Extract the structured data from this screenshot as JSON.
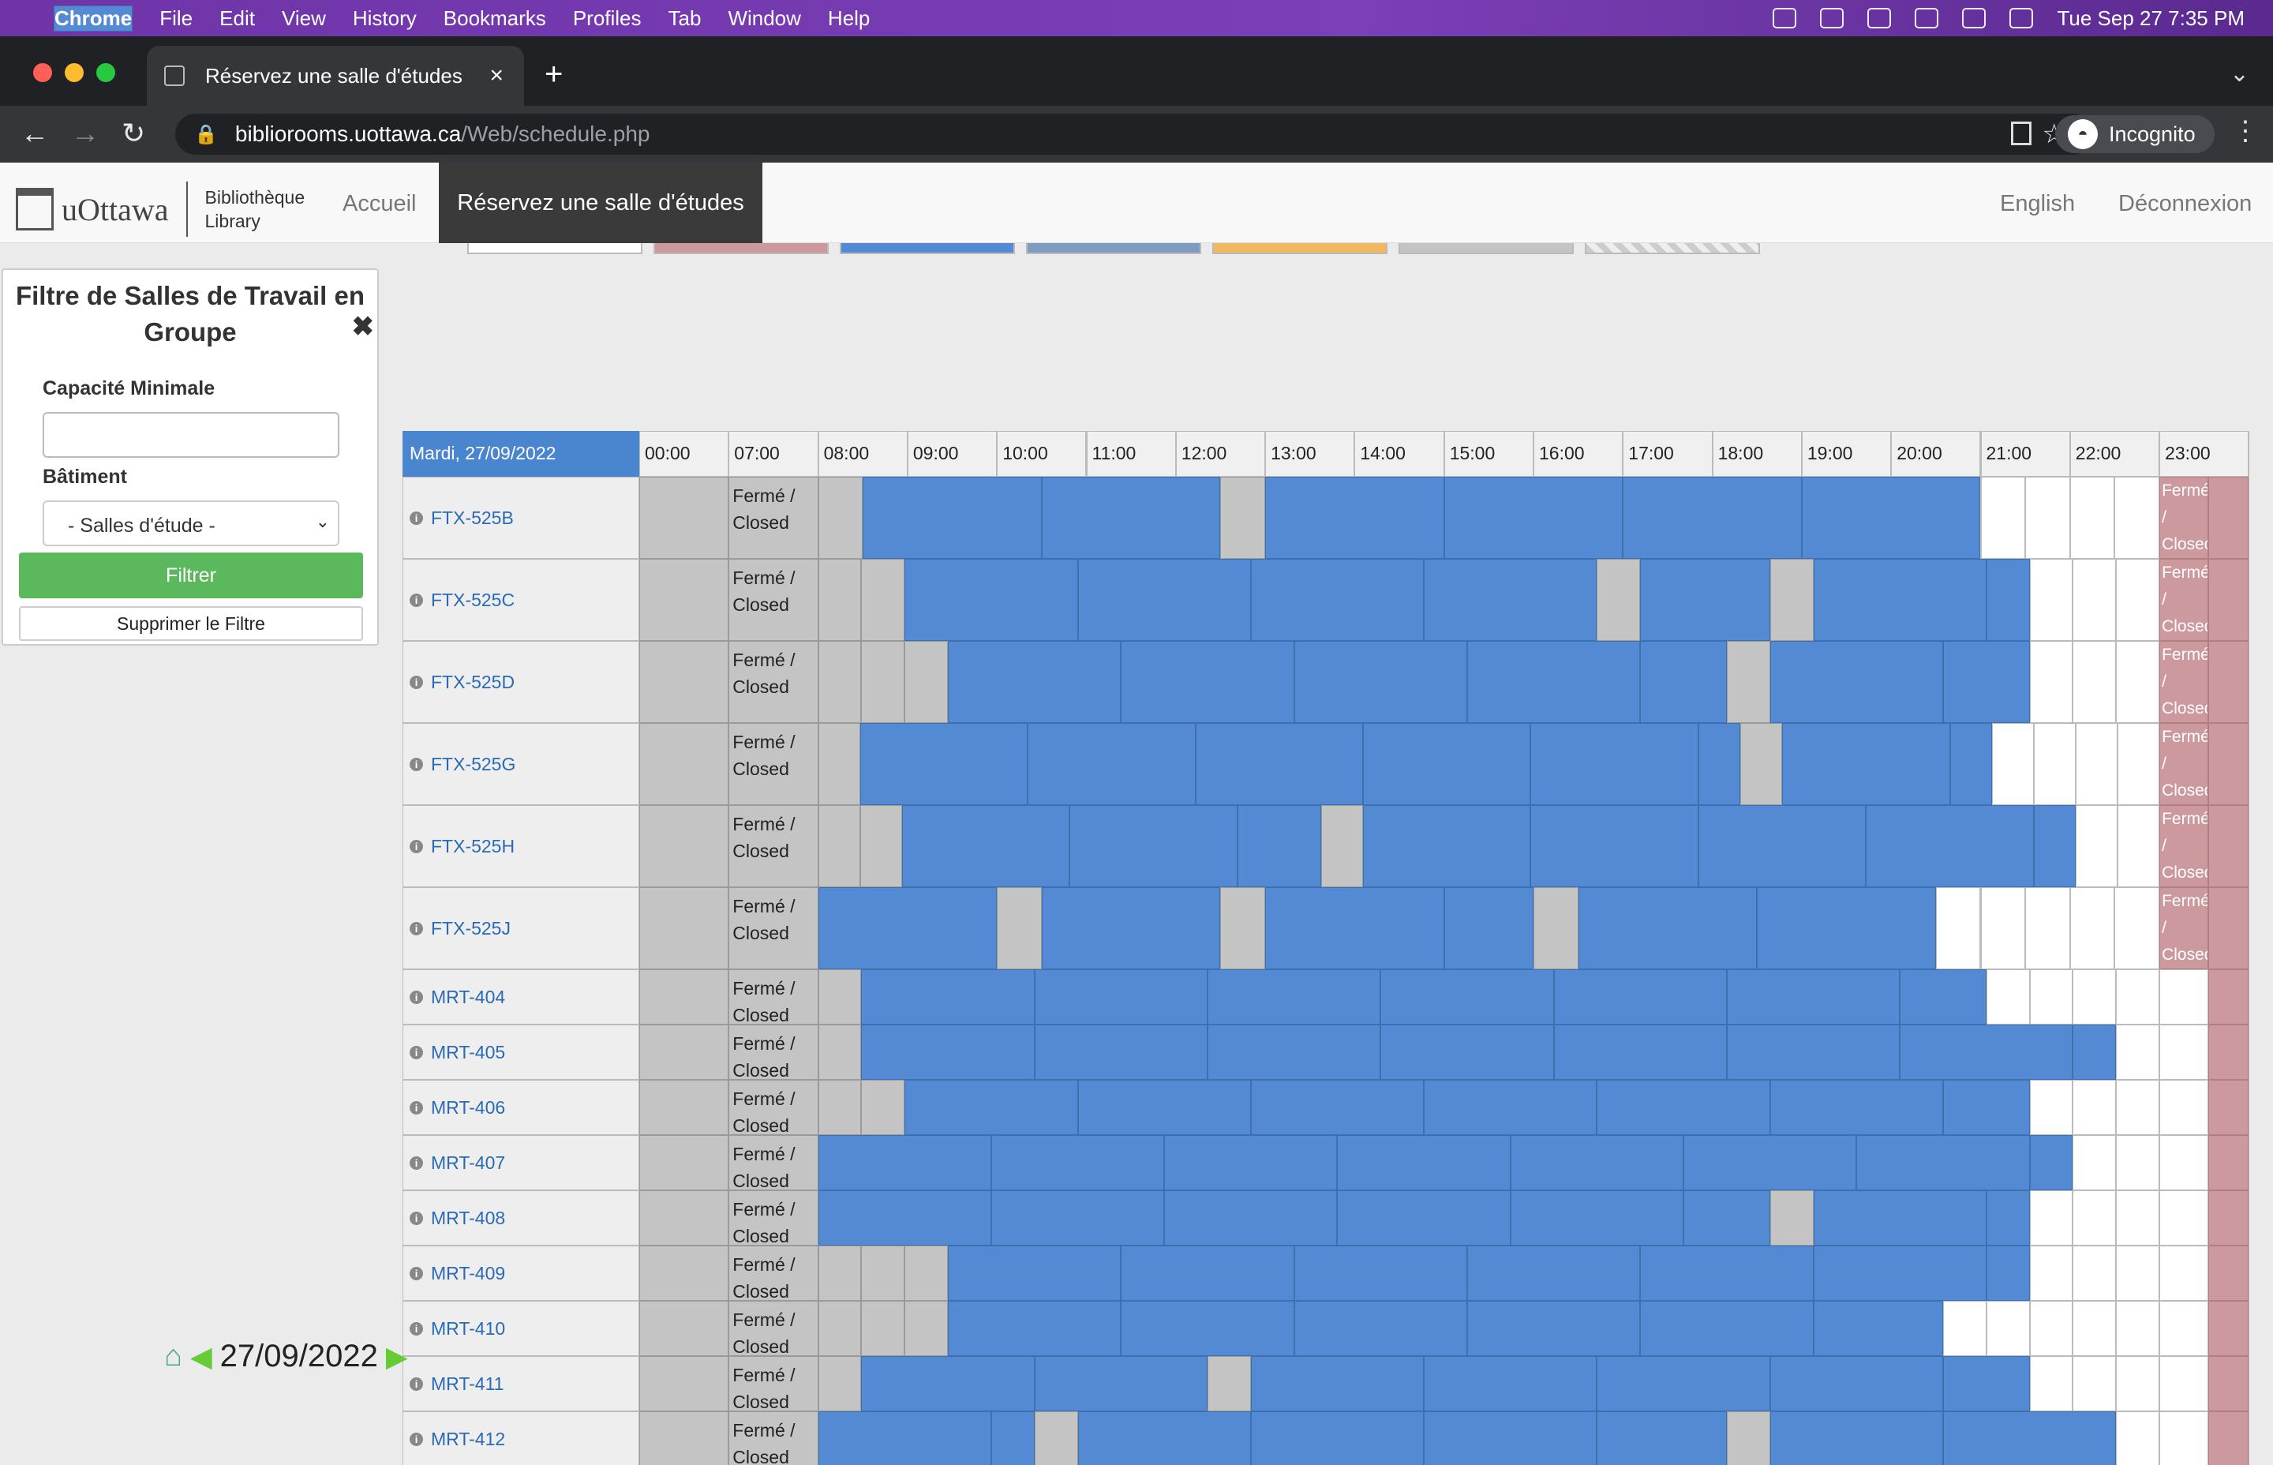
{
  "menubar": {
    "items": [
      "Chrome",
      "File",
      "Edit",
      "View",
      "History",
      "Bookmarks",
      "Profiles",
      "Tab",
      "Window",
      "Help"
    ],
    "clock": "Tue Sep 27  7:35 PM"
  },
  "browser": {
    "tab_title": "Réservez une salle d'études",
    "url_host": "bibliorooms.uottawa.ca",
    "url_path": "/Web/schedule.php",
    "incognito": "Incognito"
  },
  "site": {
    "logo": "uOttawa",
    "logo_sub1": "Bibliothèque",
    "logo_sub2": "Library",
    "nav_home": "Accueil",
    "nav_active": "Réservez une salle d'études",
    "nav_lang": "English",
    "nav_logout": "Déconnexion"
  },
  "filter": {
    "title": "Filtre de Salles de Travail en Groupe",
    "capacity_label": "Capacité Minimale",
    "capacity_value": "",
    "building_label": "Bâtiment",
    "building_selected": "- Salles d'étude -",
    "filter_button": "Filtrer",
    "clear_button": "Supprimer le Filtre"
  },
  "schedule": {
    "date_header": "Mardi, 27/09/2022",
    "hours": [
      "00:00",
      "07:00",
      "08:00",
      "09:00",
      "10:00",
      "11:00",
      "12:00",
      "13:00",
      "14:00",
      "15:00",
      "16:00",
      "17:00",
      "18:00",
      "19:00",
      "20:00",
      "21:00",
      "22:00",
      "23:00"
    ],
    "closed_label": "Fermé / Closed",
    "rooms": [
      {
        "name": "FTX-525B",
        "tall": true,
        "slots": "GbbbbbbbbbbbbbbbbbbbbbbbbbbbwwwwP",
        "grey_slots": [
          0,
          6
        ]
      },
      {
        "name": "FTX-525C",
        "tall": true,
        "slots": "G",
        "grey_slots": []
      },
      {
        "name": "FTX-525D",
        "tall": true
      },
      {
        "name": "FTX-525G",
        "tall": true
      },
      {
        "name": "FTX-525H",
        "tall": true
      },
      {
        "name": "FTX-525J",
        "tall": true
      },
      {
        "name": "MRT-404"
      },
      {
        "name": "MRT-405"
      },
      {
        "name": "MRT-406"
      },
      {
        "name": "MRT-407"
      },
      {
        "name": "MRT-408"
      },
      {
        "name": "MRT-409"
      },
      {
        "name": "MRT-410"
      },
      {
        "name": "MRT-411"
      },
      {
        "name": "MRT-412"
      }
    ]
  },
  "date_nav": {
    "date": "27/09/2022"
  }
}
